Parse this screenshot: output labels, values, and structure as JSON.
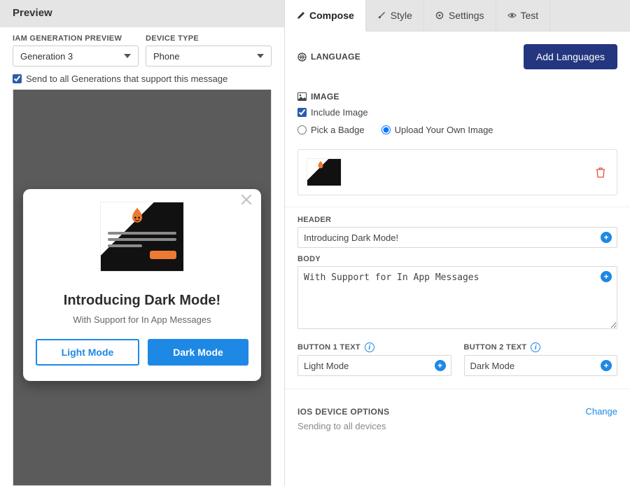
{
  "left": {
    "header": "Preview",
    "gen_label": "IAM GENERATION PREVIEW",
    "gen_value": "Generation 3",
    "device_label": "DEVICE TYPE",
    "device_value": "Phone",
    "send_all": "Send to all Generations that support this message",
    "card": {
      "title": "Introducing Dark Mode!",
      "subtitle": "With Support for In App Messages",
      "btn1": "Light Mode",
      "btn2": "Dark Mode"
    }
  },
  "tabs": {
    "compose": "Compose",
    "style": "Style",
    "settings": "Settings",
    "test": "Test"
  },
  "lang": {
    "title": "LANGUAGE",
    "add_btn": "Add Languages"
  },
  "image_sec": {
    "title": "IMAGE",
    "include": "Include Image",
    "pick_badge": "Pick a Badge",
    "upload": "Upload Your Own Image"
  },
  "header_field": {
    "label": "HEADER",
    "value": "Introducing Dark Mode!"
  },
  "body_field": {
    "label": "BODY",
    "value": "With Support for In App Messages"
  },
  "btn1_field": {
    "label": "BUTTON 1 TEXT",
    "value": "Light Mode"
  },
  "btn2_field": {
    "label": "BUTTON 2 TEXT",
    "value": "Dark Mode"
  },
  "ios": {
    "title": "IOS DEVICE OPTIONS",
    "change": "Change",
    "sub": "Sending to all devices"
  },
  "colors": {
    "primary_btn_bg": "#24367f",
    "accent": "#1e88e5",
    "flame": "#ed7a32"
  }
}
